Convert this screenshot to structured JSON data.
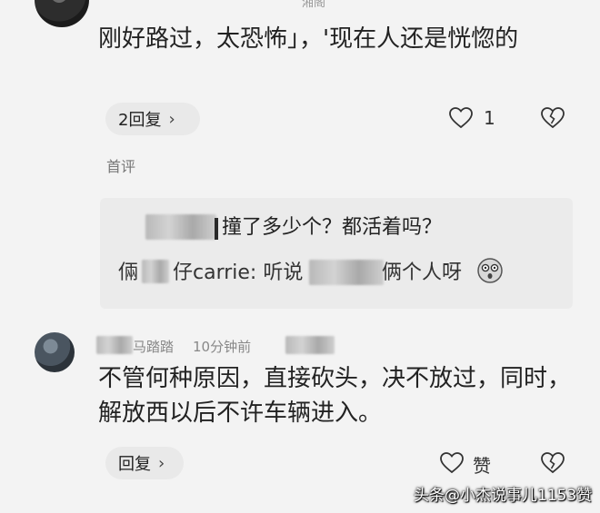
{
  "comment1": {
    "text": "刚好路过，太恐怖」，'现在人还是恍惚的",
    "reply_button": "2回复",
    "like_count": "1"
  },
  "top_cut_text": "湘阁",
  "first_comment_tag": "首评",
  "quote": {
    "line1": "撞了多少个？都活着吗？",
    "line2_prefix": "倆",
    "line2_name": "仔carrie: 听说",
    "line2_suffix": "俩个人呀"
  },
  "comment2": {
    "author": "马踏踏",
    "time": "10分钟前",
    "text": "不管何种原因，直接砍头，决不放过，同时，解放西以后不许车辆进入。",
    "reply_button": "回复",
    "like_label": "赞"
  },
  "watermark": "头条@小杰说事儿1153赞",
  "icons": {
    "heart": "heart-icon",
    "broken_heart": "broken-heart-icon",
    "chevron": "chevron-right-icon",
    "emoji": "shocked-face-emoji-icon"
  },
  "colors": {
    "background": "#f3f3f3",
    "quote_bg": "#ebebeb",
    "button_bg": "#e9e9e9"
  }
}
